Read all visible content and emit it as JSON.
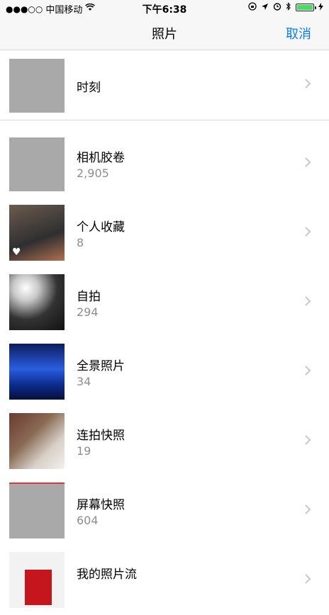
{
  "status": {
    "carrier": "中国移动",
    "signal_dots": "●●●○○",
    "time": "下午6:38",
    "battery_level": 1.0
  },
  "nav": {
    "title": "照片",
    "cancel_label": "取消"
  },
  "albums": [
    {
      "name": "时刻",
      "count": ""
    },
    {
      "name": "相机胶卷",
      "count": "2,905"
    },
    {
      "name": "个人收藏",
      "count": "8"
    },
    {
      "name": "自拍",
      "count": "294"
    },
    {
      "name": "全景照片",
      "count": "34"
    },
    {
      "name": "连拍快照",
      "count": "19"
    },
    {
      "name": "屏幕快照",
      "count": "604"
    },
    {
      "name": "我的照片流",
      "count": ""
    }
  ],
  "colors": {
    "accent": "#0a7bff",
    "battery": "#4cd964",
    "secondary_text": "#8e8e93"
  }
}
